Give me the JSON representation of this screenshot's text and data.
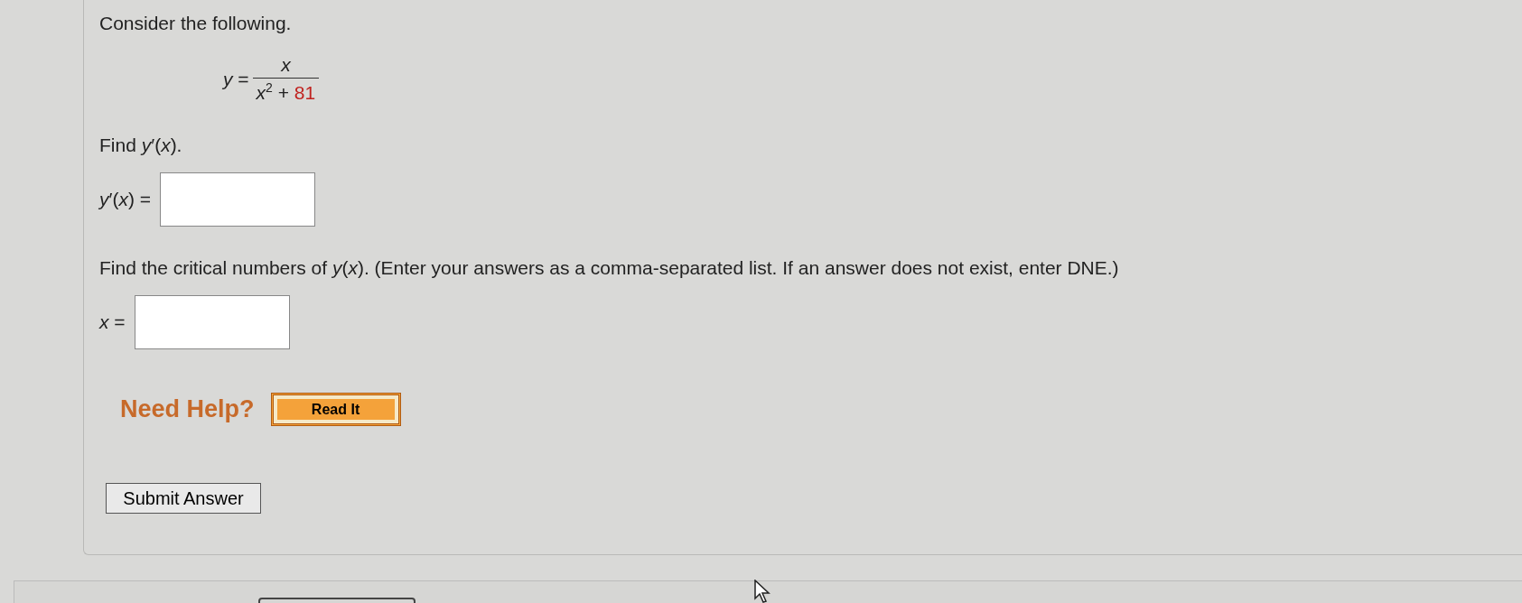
{
  "intro": "Consider the following.",
  "equation": {
    "lhs": "*y* =",
    "numerator": "*x*",
    "denominator": {
      "base": "*x*",
      "exponent": "2",
      "operator": "+",
      "constant": "81"
    }
  },
  "parts": [
    {
      "prompt": "Find *y*′(*x*).",
      "label": "*y*′(*x*) ="
    },
    {
      "prompt": "Find the critical numbers of *y*(*x*). (Enter your answers as a comma-separated list. If an answer does not exist, enter DNE.)",
      "label": "*x* ="
    }
  ],
  "help": {
    "label": "Need Help?",
    "buttons": [
      "Read It"
    ]
  },
  "submit": "Submit Answer"
}
